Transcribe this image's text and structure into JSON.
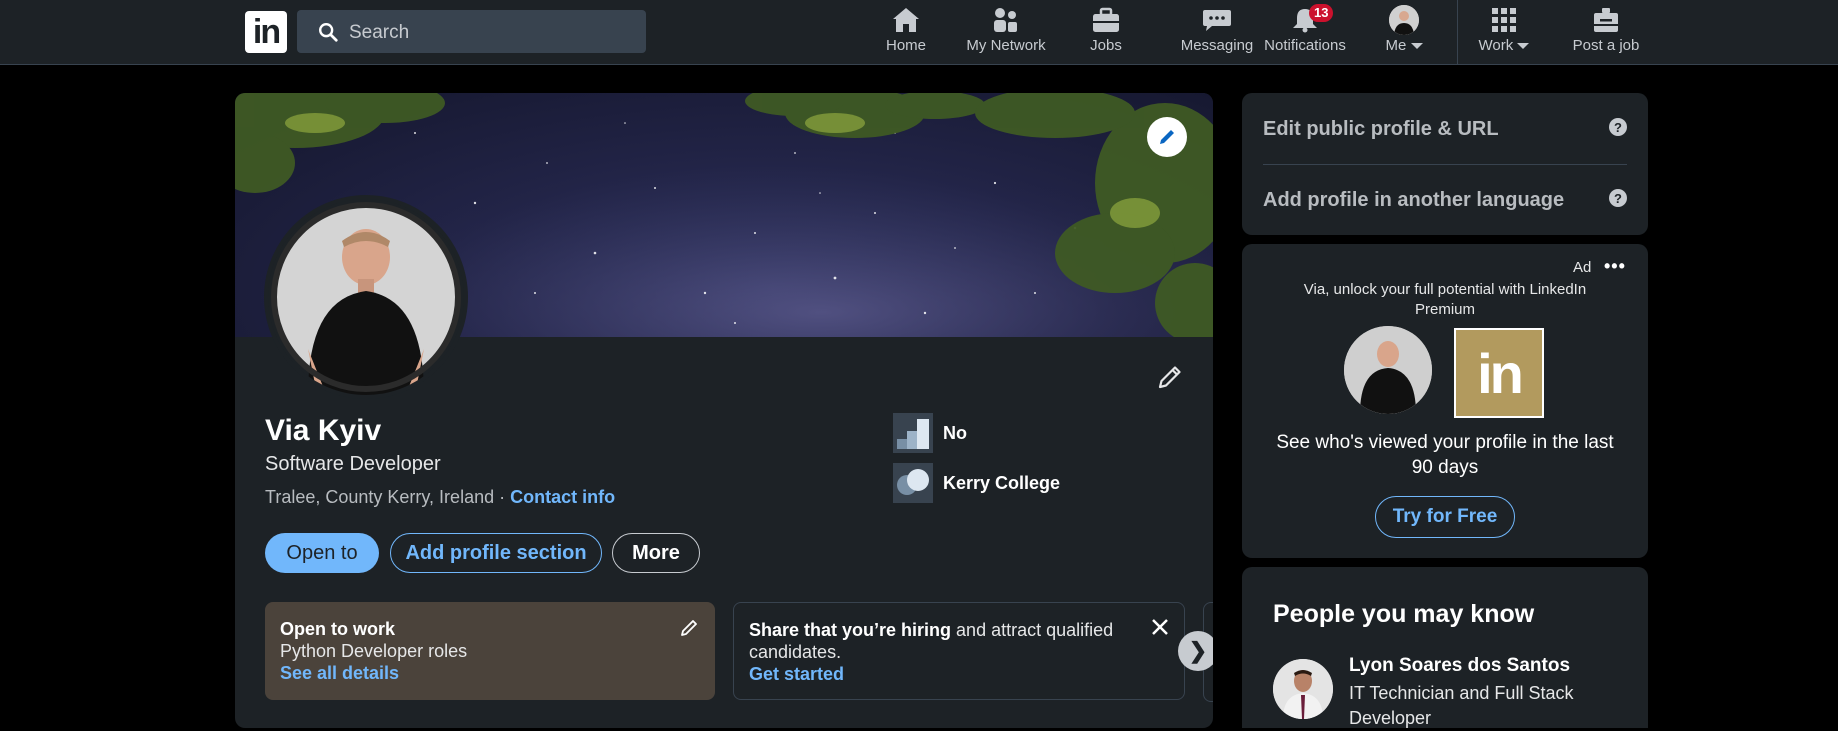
{
  "nav": {
    "logo_text": "in",
    "search_placeholder": "Search",
    "items": [
      {
        "label": "Home",
        "icon": "home-icon"
      },
      {
        "label": "My Network",
        "icon": "network-icon"
      },
      {
        "label": "Jobs",
        "icon": "briefcase-icon"
      },
      {
        "label": "Messaging",
        "icon": "messaging-icon"
      },
      {
        "label": "Notifications",
        "icon": "bell-icon",
        "badge": "13"
      },
      {
        "label": "Me",
        "icon": "avatar"
      },
      {
        "label": "Work",
        "icon": "grid-icon"
      },
      {
        "label": "Post a job",
        "icon": "post-job-icon"
      }
    ]
  },
  "profile": {
    "name": "Via Kyiv",
    "headline": "Software Developer",
    "location": "Tralee, County Kerry, Ireland",
    "location_separator": " · ",
    "contact_info": "Contact info",
    "buttons": {
      "open_to": "Open to",
      "add_section": "Add profile section",
      "more": "More"
    },
    "experience": [
      {
        "label": "No"
      },
      {
        "label": "Kerry College"
      }
    ],
    "open_to_work": {
      "title": "Open to work",
      "roles": "Python Developer roles",
      "link": "See all details"
    },
    "hiring": {
      "bold": "Share that you’re hiring",
      "rest": " and attract qualified candidates.",
      "link": "Get started"
    },
    "carousel_next": "❯"
  },
  "sidebar": {
    "links": [
      {
        "label": "Edit public profile & URL"
      },
      {
        "label": "Add profile in another language"
      }
    ],
    "ad": {
      "label": "Ad",
      "dots": "•••",
      "text": "Via, unlock your full potential with LinkedIn Premium",
      "logo_text": "in",
      "headline": "See who's viewed your profile in the last 90 days",
      "button": "Try for Free"
    },
    "pymk": {
      "title": "People you may know",
      "person": {
        "name": "Lyon Soares dos Santos",
        "description": "IT Technician and Full Stack Developer"
      }
    }
  },
  "colors": {
    "accent": "#71b7fb",
    "card_bg": "#1d2226",
    "badge": "#cb112d",
    "open_to_work_bg": "#4b433b"
  }
}
